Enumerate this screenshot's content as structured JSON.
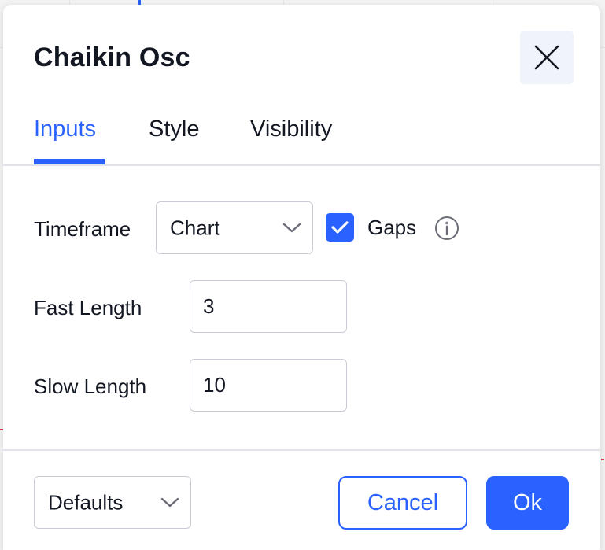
{
  "dialog": {
    "title": "Chaikin Osc",
    "close_icon": "close-icon"
  },
  "tabs": [
    {
      "label": "Inputs",
      "active": true
    },
    {
      "label": "Style",
      "active": false
    },
    {
      "label": "Visibility",
      "active": false
    }
  ],
  "inputs": {
    "timeframe": {
      "label": "Timeframe",
      "value": "Chart",
      "icon": "chevron-down-icon"
    },
    "gaps": {
      "label": "Gaps",
      "checked": true,
      "icon": "info-icon"
    },
    "fast_length": {
      "label": "Fast Length",
      "value": "3"
    },
    "slow_length": {
      "label": "Slow Length",
      "value": "10"
    }
  },
  "footer": {
    "defaults_label": "Defaults",
    "cancel_label": "Cancel",
    "ok_label": "Ok"
  },
  "colors": {
    "accent": "#2962ff",
    "text": "#131722",
    "border": "#c9ccd4",
    "close_bg": "#f0f3fa"
  }
}
